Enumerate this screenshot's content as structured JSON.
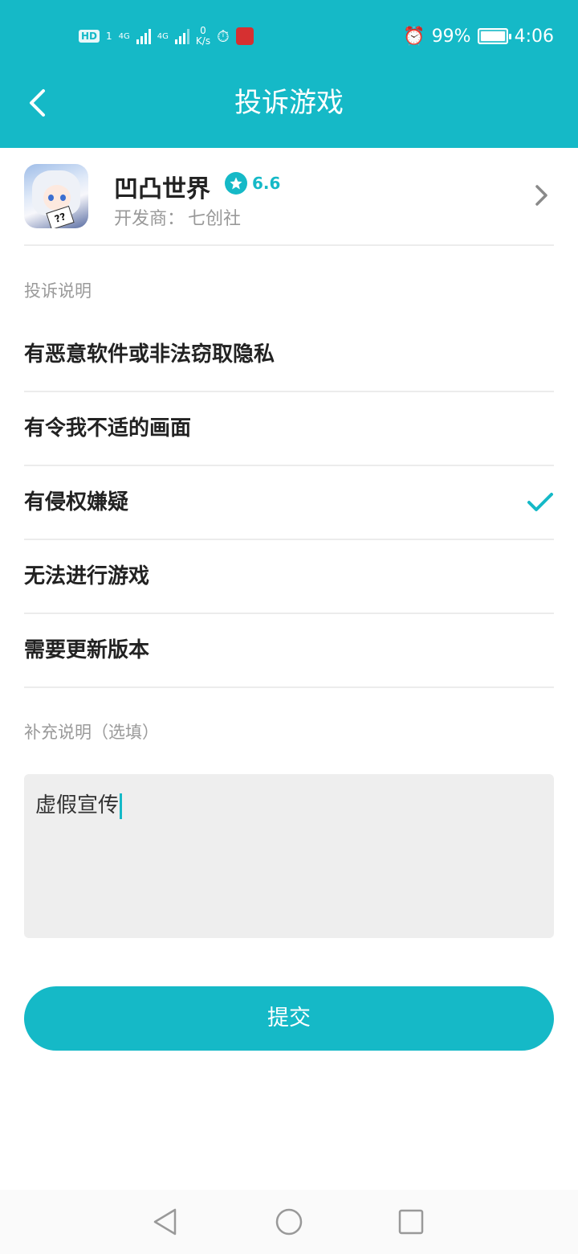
{
  "statusbar": {
    "hd": "HD",
    "sim_slot": "1",
    "net1": "4G",
    "net2": "4G",
    "speed_value": "0",
    "speed_unit": "K/s",
    "battery": "99%",
    "time": "4:06"
  },
  "header": {
    "title": "投诉游戏"
  },
  "game": {
    "name": "凹凸世界",
    "rating": "6.6",
    "developer_label": "开发商：",
    "developer_name": "七创社",
    "icon_card_text": "??"
  },
  "complaint": {
    "section_label": "投诉说明",
    "options": [
      {
        "label": "有恶意软件或非法窃取隐私",
        "selected": false
      },
      {
        "label": "有令我不适的画面",
        "selected": false
      },
      {
        "label": "有侵权嫌疑",
        "selected": true
      },
      {
        "label": "无法进行游戏",
        "selected": false
      },
      {
        "label": "需要更新版本",
        "selected": false
      }
    ]
  },
  "supplement": {
    "section_label": "补充说明（选填）",
    "value": "虚假宣传"
  },
  "submit_label": "提交",
  "colors": {
    "accent": "#15b9c7",
    "text": "#222222",
    "muted": "#999999",
    "input_bg": "#eeeeee"
  }
}
